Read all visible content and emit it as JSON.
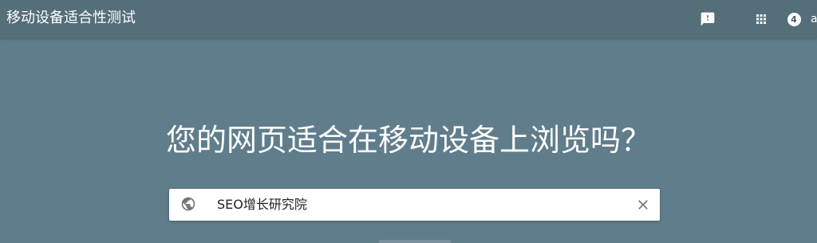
{
  "header": {
    "title": "移动设备适合性测试",
    "icons": {
      "feedback": "feedback-icon",
      "apps": "apps-grid-icon",
      "notifications": "notifications-icon"
    },
    "notification_count": "4",
    "account_partial": "a"
  },
  "main": {
    "headline": "您的网页适合在移动设备上浏览吗？",
    "url_field": {
      "value": "SEO增长研究院",
      "icon": "globe-icon",
      "clear_icon": "close-icon"
    }
  },
  "colors": {
    "background": "#607d8b",
    "topbar": "#546e7a",
    "text_light": "#ffffff"
  }
}
